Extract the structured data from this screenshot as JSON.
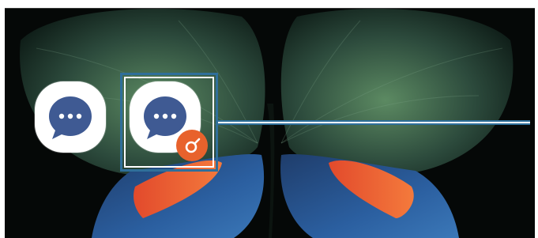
{
  "screen": {
    "wallpaper": "butterfly-wing-wallpaper",
    "background_color": "#050807"
  },
  "apps": [
    {
      "name": "messages-app",
      "icon": "chat-bubble-dots-icon",
      "color": "#3f5a93"
    },
    {
      "name": "messages-app-clone",
      "icon": "chat-bubble-dots-icon",
      "color": "#3f5a93",
      "badge": "dual-messenger-badge-icon",
      "badge_color": "#e8622c"
    }
  ],
  "callout": {
    "color": "#2f6f9a",
    "inner_color": "#ffffff"
  }
}
